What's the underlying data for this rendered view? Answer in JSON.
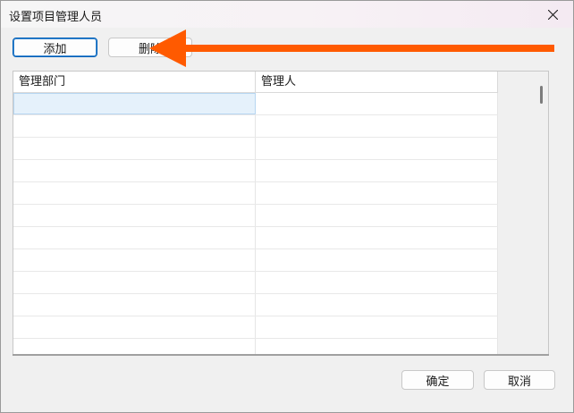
{
  "window": {
    "title": "设置项目管理人员"
  },
  "toolbar": {
    "add_label": "添加",
    "delete_label": "删除"
  },
  "table": {
    "columns": [
      "管理部门",
      "管理人"
    ],
    "rows": [
      [
        "",
        ""
      ],
      [
        "",
        ""
      ],
      [
        "",
        ""
      ],
      [
        "",
        ""
      ],
      [
        "",
        ""
      ],
      [
        "",
        ""
      ],
      [
        "",
        ""
      ],
      [
        "",
        ""
      ],
      [
        "",
        ""
      ],
      [
        "",
        ""
      ],
      [
        "",
        ""
      ],
      [
        "",
        ""
      ]
    ]
  },
  "footer": {
    "ok_label": "确定",
    "cancel_label": "取消"
  },
  "colors": {
    "accent": "#005fb8",
    "annotation_arrow": "#ff5a00",
    "selection": "#e5f1fb"
  },
  "icons": {
    "close": "close-icon",
    "annotation": "arrow-left-icon"
  }
}
